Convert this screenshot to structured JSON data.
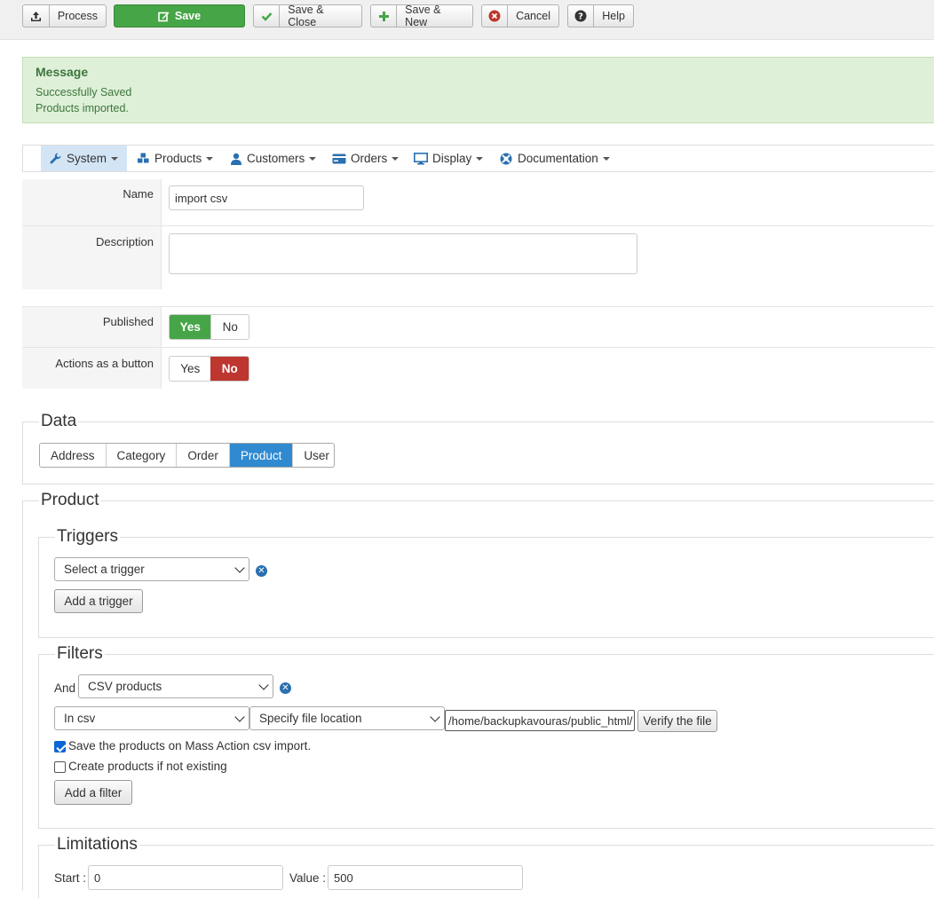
{
  "toolbar": {
    "process": "Process",
    "save": "Save",
    "save_close": "Save & Close",
    "save_new": "Save & New",
    "cancel": "Cancel",
    "help": "Help"
  },
  "message": {
    "heading": "Message",
    "lines": [
      "Successfully Saved",
      "Products imported."
    ]
  },
  "nav": {
    "items": [
      {
        "label": "System",
        "icon": "wrench-icon"
      },
      {
        "label": "Products",
        "icon": "cubes-icon"
      },
      {
        "label": "Customers",
        "icon": "user-icon"
      },
      {
        "label": "Orders",
        "icon": "credit-card-icon"
      },
      {
        "label": "Display",
        "icon": "monitor-icon"
      },
      {
        "label": "Documentation",
        "icon": "lifebuoy-icon"
      }
    ],
    "active": "System"
  },
  "form": {
    "name_label": "Name",
    "name_value": "import csv",
    "description_label": "Description",
    "description_value": "",
    "published_label": "Published",
    "published_yes": "Yes",
    "published_no": "No",
    "published_value": "Yes",
    "actions_label": "Actions as a button",
    "actions_yes": "Yes",
    "actions_no": "No",
    "actions_value": "No"
  },
  "data_section": {
    "legend": "Data",
    "tabs": [
      "Address",
      "Category",
      "Order",
      "Product",
      "User"
    ],
    "selected": "Product"
  },
  "product_section": {
    "legend": "Product",
    "triggers": {
      "legend": "Triggers",
      "select_value": "Select a trigger",
      "add_button": "Add a trigger"
    },
    "filters": {
      "legend": "Filters",
      "and_label": "And",
      "type_value": "CSV products",
      "source_value": "In csv",
      "location_value": "Specify file location",
      "path_value": "/home/backupkavouras/public_html/",
      "verify_button": "Verify the file",
      "option_save_label": "Save the products on Mass Action csv import.",
      "option_save_checked": true,
      "option_create_label": "Create products if not existing",
      "option_create_checked": false,
      "add_button": "Add a filter"
    },
    "limitations": {
      "legend": "Limitations",
      "start_label": "Start :",
      "start_value": "0",
      "value_label": "Value :",
      "value_value": "500"
    }
  },
  "colors": {
    "primary_green": "#46a546",
    "danger_red": "#bd362f",
    "selected_blue": "#2f8ad0",
    "message_bg": "#dff0d8",
    "message_text": "#3c763d",
    "nav_active_bg": "#d3e5f5"
  }
}
